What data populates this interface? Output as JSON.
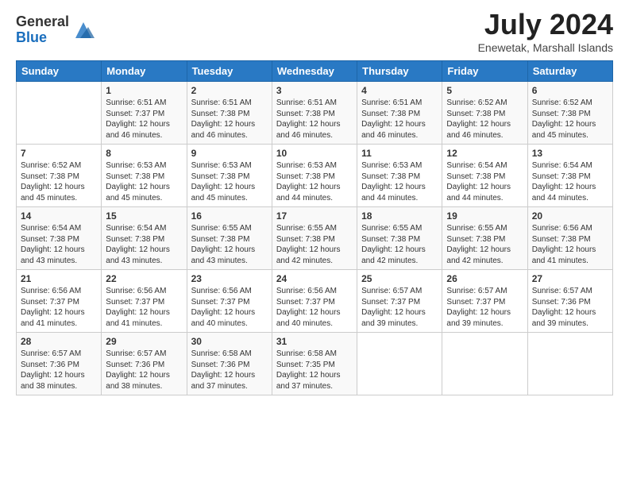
{
  "header": {
    "logo_general": "General",
    "logo_blue": "Blue",
    "month_year": "July 2024",
    "location": "Enewetak, Marshall Islands"
  },
  "weekdays": [
    "Sunday",
    "Monday",
    "Tuesday",
    "Wednesday",
    "Thursday",
    "Friday",
    "Saturday"
  ],
  "weeks": [
    [
      {
        "day": null,
        "info": null
      },
      {
        "day": "1",
        "info": "Sunrise: 6:51 AM\nSunset: 7:37 PM\nDaylight: 12 hours\nand 46 minutes."
      },
      {
        "day": "2",
        "info": "Sunrise: 6:51 AM\nSunset: 7:38 PM\nDaylight: 12 hours\nand 46 minutes."
      },
      {
        "day": "3",
        "info": "Sunrise: 6:51 AM\nSunset: 7:38 PM\nDaylight: 12 hours\nand 46 minutes."
      },
      {
        "day": "4",
        "info": "Sunrise: 6:51 AM\nSunset: 7:38 PM\nDaylight: 12 hours\nand 46 minutes."
      },
      {
        "day": "5",
        "info": "Sunrise: 6:52 AM\nSunset: 7:38 PM\nDaylight: 12 hours\nand 46 minutes."
      },
      {
        "day": "6",
        "info": "Sunrise: 6:52 AM\nSunset: 7:38 PM\nDaylight: 12 hours\nand 45 minutes."
      }
    ],
    [
      {
        "day": "7",
        "info": "Sunrise: 6:52 AM\nSunset: 7:38 PM\nDaylight: 12 hours\nand 45 minutes."
      },
      {
        "day": "8",
        "info": "Sunrise: 6:53 AM\nSunset: 7:38 PM\nDaylight: 12 hours\nand 45 minutes."
      },
      {
        "day": "9",
        "info": "Sunrise: 6:53 AM\nSunset: 7:38 PM\nDaylight: 12 hours\nand 45 minutes."
      },
      {
        "day": "10",
        "info": "Sunrise: 6:53 AM\nSunset: 7:38 PM\nDaylight: 12 hours\nand 44 minutes."
      },
      {
        "day": "11",
        "info": "Sunrise: 6:53 AM\nSunset: 7:38 PM\nDaylight: 12 hours\nand 44 minutes."
      },
      {
        "day": "12",
        "info": "Sunrise: 6:54 AM\nSunset: 7:38 PM\nDaylight: 12 hours\nand 44 minutes."
      },
      {
        "day": "13",
        "info": "Sunrise: 6:54 AM\nSunset: 7:38 PM\nDaylight: 12 hours\nand 44 minutes."
      }
    ],
    [
      {
        "day": "14",
        "info": "Sunrise: 6:54 AM\nSunset: 7:38 PM\nDaylight: 12 hours\nand 43 minutes."
      },
      {
        "day": "15",
        "info": "Sunrise: 6:54 AM\nSunset: 7:38 PM\nDaylight: 12 hours\nand 43 minutes."
      },
      {
        "day": "16",
        "info": "Sunrise: 6:55 AM\nSunset: 7:38 PM\nDaylight: 12 hours\nand 43 minutes."
      },
      {
        "day": "17",
        "info": "Sunrise: 6:55 AM\nSunset: 7:38 PM\nDaylight: 12 hours\nand 42 minutes."
      },
      {
        "day": "18",
        "info": "Sunrise: 6:55 AM\nSunset: 7:38 PM\nDaylight: 12 hours\nand 42 minutes."
      },
      {
        "day": "19",
        "info": "Sunrise: 6:55 AM\nSunset: 7:38 PM\nDaylight: 12 hours\nand 42 minutes."
      },
      {
        "day": "20",
        "info": "Sunrise: 6:56 AM\nSunset: 7:38 PM\nDaylight: 12 hours\nand 41 minutes."
      }
    ],
    [
      {
        "day": "21",
        "info": "Sunrise: 6:56 AM\nSunset: 7:37 PM\nDaylight: 12 hours\nand 41 minutes."
      },
      {
        "day": "22",
        "info": "Sunrise: 6:56 AM\nSunset: 7:37 PM\nDaylight: 12 hours\nand 41 minutes."
      },
      {
        "day": "23",
        "info": "Sunrise: 6:56 AM\nSunset: 7:37 PM\nDaylight: 12 hours\nand 40 minutes."
      },
      {
        "day": "24",
        "info": "Sunrise: 6:56 AM\nSunset: 7:37 PM\nDaylight: 12 hours\nand 40 minutes."
      },
      {
        "day": "25",
        "info": "Sunrise: 6:57 AM\nSunset: 7:37 PM\nDaylight: 12 hours\nand 39 minutes."
      },
      {
        "day": "26",
        "info": "Sunrise: 6:57 AM\nSunset: 7:37 PM\nDaylight: 12 hours\nand 39 minutes."
      },
      {
        "day": "27",
        "info": "Sunrise: 6:57 AM\nSunset: 7:36 PM\nDaylight: 12 hours\nand 39 minutes."
      }
    ],
    [
      {
        "day": "28",
        "info": "Sunrise: 6:57 AM\nSunset: 7:36 PM\nDaylight: 12 hours\nand 38 minutes."
      },
      {
        "day": "29",
        "info": "Sunrise: 6:57 AM\nSunset: 7:36 PM\nDaylight: 12 hours\nand 38 minutes."
      },
      {
        "day": "30",
        "info": "Sunrise: 6:58 AM\nSunset: 7:36 PM\nDaylight: 12 hours\nand 37 minutes."
      },
      {
        "day": "31",
        "info": "Sunrise: 6:58 AM\nSunset: 7:35 PM\nDaylight: 12 hours\nand 37 minutes."
      },
      {
        "day": null,
        "info": null
      },
      {
        "day": null,
        "info": null
      },
      {
        "day": null,
        "info": null
      }
    ]
  ]
}
